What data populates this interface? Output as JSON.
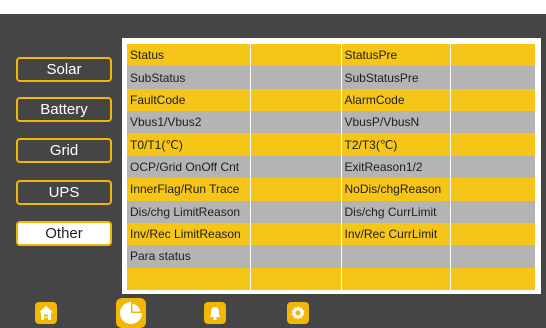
{
  "nav": {
    "items": [
      {
        "label": "Solar"
      },
      {
        "label": "Battery"
      },
      {
        "label": "Grid"
      },
      {
        "label": "UPS"
      },
      {
        "label": "Other"
      }
    ],
    "active": "Other"
  },
  "table": {
    "rows": [
      [
        "Status",
        "",
        "StatusPre",
        ""
      ],
      [
        "SubStatus",
        "",
        "SubStatusPre",
        ""
      ],
      [
        "FaultCode",
        "",
        "AlarmCode",
        ""
      ],
      [
        "Vbus1/Vbus2",
        "",
        "VbusP/VbusN",
        ""
      ],
      [
        "T0/T1(℃)",
        "",
        "T2/T3(℃)",
        ""
      ],
      [
        "OCP/Grid OnOff Cnt",
        "",
        "ExitReason1/2",
        ""
      ],
      [
        "InnerFlag/Run Trace",
        "",
        "NoDis/chgReason",
        ""
      ],
      [
        "Dis/chg LimitReason",
        "",
        "Dis/chg CurrLimit",
        ""
      ],
      [
        "Inv/Rec LimitReason",
        "",
        "Inv/Rec CurrLimit",
        ""
      ],
      [
        "Para status",
        "",
        "",
        ""
      ],
      [
        "",
        "",
        "",
        ""
      ]
    ]
  },
  "bottom_nav": {
    "icons": [
      "home-icon",
      "pie-chart-icon",
      "bell-icon",
      "settings-gear-icon"
    ],
    "active": "pie-chart-icon"
  },
  "colors": {
    "accent": "#f2b705",
    "row_yellow": "#f5c518",
    "row_gray": "#b4b4b4",
    "background": "#454545"
  }
}
